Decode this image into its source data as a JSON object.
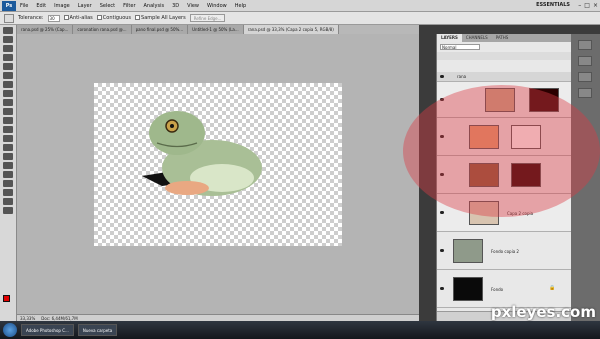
{
  "app": {
    "logo": "Ps",
    "workspace": "ESSENTIALS"
  },
  "menu": [
    "File",
    "Edit",
    "Image",
    "Layer",
    "Select",
    "Filter",
    "Analysis",
    "3D",
    "View",
    "Window",
    "Help"
  ],
  "options": {
    "tolerance_label": "Tolerance:",
    "tolerance_value": "30",
    "antialias": "Anti-alias",
    "contiguous": "Contiguous",
    "sample_all": "Sample All Layers",
    "refine": "Refine Edge..."
  },
  "doc_tabs": [
    "rana.psd @ 25% (Cap...",
    "coronation rana.psd @...",
    "pano final.psd @ 50%...",
    "Untitled-1 @ 50% (La...",
    "rana.psd @ 33,3% (Capa 2 copia 5, RGB/8)"
  ],
  "status": {
    "zoom": "33,33%",
    "doc": "Doc: 6,44M/61,7M"
  },
  "layers_panel": {
    "tabs": [
      "LAYERS",
      "CHANNELS",
      "PATHS"
    ],
    "blend_mode": "Normal",
    "layers": [
      {
        "name": "rana",
        "kind": "group"
      },
      {
        "name": "",
        "kind": "masked"
      },
      {
        "name": "",
        "kind": "masked"
      },
      {
        "name": "",
        "kind": "masked"
      },
      {
        "name": "Capa 2 copia",
        "kind": "normal"
      },
      {
        "name": "Fondo copia 2",
        "kind": "normal"
      },
      {
        "name": "Fondo",
        "kind": "background"
      }
    ]
  },
  "taskbar": {
    "task1": "Adobe Photoshop C...",
    "task2": "Nueva carpeta"
  },
  "watermark": "pxleyes.com",
  "colors": {
    "foreground": "#e00000",
    "highlight": "#dc3c46"
  }
}
